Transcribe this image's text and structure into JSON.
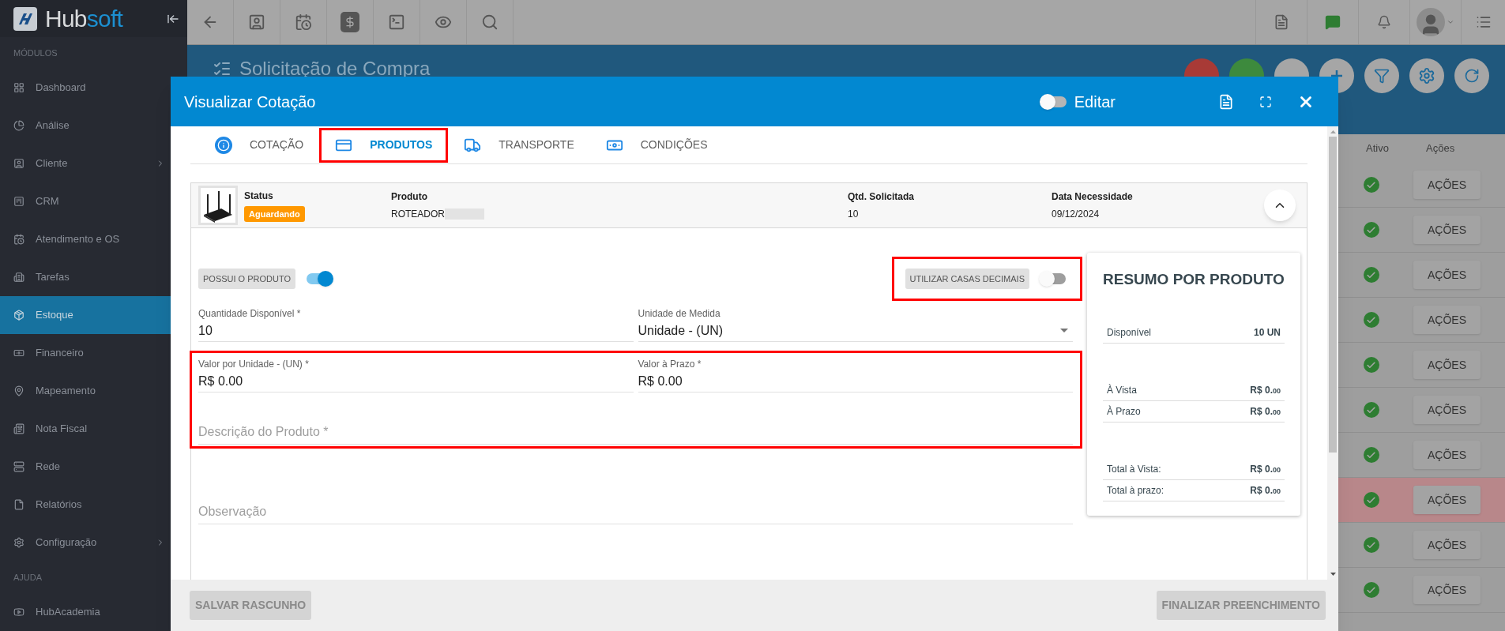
{
  "logo": {
    "parts": [
      "Hub",
      "soft"
    ]
  },
  "sidebar": {
    "sections": [
      {
        "heading": "MÓDULOS",
        "items": [
          {
            "label": "Dashboard",
            "selected": false,
            "submenu": false
          },
          {
            "label": "Análise",
            "selected": false,
            "submenu": false
          },
          {
            "label": "Cliente",
            "selected": false,
            "submenu": true
          },
          {
            "label": "CRM",
            "selected": false,
            "submenu": false
          },
          {
            "label": "Atendimento e OS",
            "selected": false,
            "submenu": false
          },
          {
            "label": "Tarefas",
            "selected": false,
            "submenu": false
          },
          {
            "label": "Estoque",
            "selected": true,
            "submenu": false
          },
          {
            "label": "Financeiro",
            "selected": false,
            "submenu": false
          },
          {
            "label": "Mapeamento",
            "selected": false,
            "submenu": false
          },
          {
            "label": "Nota Fiscal",
            "selected": false,
            "submenu": false
          },
          {
            "label": "Rede",
            "selected": false,
            "submenu": false
          },
          {
            "label": "Relatórios",
            "selected": false,
            "submenu": false
          },
          {
            "label": "Configuração",
            "selected": false,
            "submenu": true
          }
        ]
      },
      {
        "heading": "AJUDA",
        "items": [
          {
            "label": "HubAcademia",
            "selected": false,
            "submenu": false
          }
        ]
      }
    ]
  },
  "page": {
    "title": "Solicitação de Compra",
    "table": {
      "columns": [
        "Ativo",
        "Ações"
      ],
      "rows": [
        {
          "active": true,
          "highlighted": false,
          "action": "AÇÕES"
        },
        {
          "active": true,
          "highlighted": false,
          "action": "AÇÕES"
        },
        {
          "active": true,
          "highlighted": false,
          "action": "AÇÕES"
        },
        {
          "active": true,
          "highlighted": false,
          "action": "AÇÕES"
        },
        {
          "active": true,
          "highlighted": false,
          "action": "AÇÕES"
        },
        {
          "active": true,
          "highlighted": false,
          "action": "AÇÕES"
        },
        {
          "active": true,
          "highlighted": false,
          "action": "AÇÕES"
        },
        {
          "active": true,
          "highlighted": true,
          "action": "AÇÕES"
        },
        {
          "active": true,
          "highlighted": false,
          "action": "AÇÕES"
        },
        {
          "active": true,
          "highlighted": false,
          "action": "AÇÕES"
        }
      ]
    }
  },
  "modal": {
    "title": "Visualizar Cotação",
    "edit_toggle": {
      "label": "Editar",
      "on": false
    },
    "tabs": [
      {
        "label": "COTAÇÃO",
        "selected": false,
        "annotated": false
      },
      {
        "label": "PRODUTOS",
        "selected": true,
        "annotated": true
      },
      {
        "label": "TRANSPORTE",
        "selected": false,
        "annotated": false
      },
      {
        "label": "CONDIÇÕES",
        "selected": false,
        "annotated": false
      }
    ],
    "product": {
      "expanded": true,
      "columns": [
        {
          "label": "Status",
          "value": "Aguardando",
          "kind": "badge"
        },
        {
          "label": "Produto",
          "value": "ROTEADOR",
          "kind": "redacted"
        },
        {
          "label": "Qtd. Solicitada",
          "value": "10",
          "kind": "text"
        },
        {
          "label": "Data Necessidade",
          "value": "09/12/2024",
          "kind": "text"
        }
      ]
    },
    "toggles": [
      {
        "label": "POSSUI O PRODUTO",
        "on": true,
        "annotated": false
      },
      {
        "label": "UTILIZAR CASAS DECIMAIS",
        "on": false,
        "annotated": true
      }
    ],
    "field_groups": [
      {
        "annotated": false,
        "fields": [
          {
            "kind": "text",
            "label": "Quantidade Disponível *",
            "value": "10"
          },
          {
            "kind": "select",
            "label": "Unidade de Medida",
            "value": "Unidade - (UN)"
          }
        ]
      },
      {
        "annotated": true,
        "fields": [
          {
            "kind": "text",
            "label": "Valor por Unidade - (UN) *",
            "value": "R$ 0.00"
          },
          {
            "kind": "text",
            "label": "Valor à Prazo *",
            "value": "R$ 0.00"
          },
          {
            "kind": "textarea",
            "placeholder": "Descrição do Produto *"
          }
        ]
      },
      {
        "annotated": false,
        "fields": [
          {
            "kind": "textarea",
            "placeholder": "Observação"
          }
        ]
      }
    ],
    "summary": {
      "title": "RESUMO POR PRODUTO",
      "groups": [
        [
          {
            "label": "Disponível",
            "amount": "10 UN"
          }
        ],
        [
          {
            "label": "À Vista",
            "amount": "R$ 0.",
            "cents": "00"
          },
          {
            "label": "À Prazo",
            "amount": "R$ 0.",
            "cents": "00"
          }
        ],
        [
          {
            "label": "Total à Vista:",
            "amount": "R$ 0.",
            "cents": "00"
          },
          {
            "label": "Total à prazo:",
            "amount": "R$ 0.",
            "cents": "00"
          }
        ]
      ]
    },
    "footer": [
      {
        "label": "SALVAR RASCUNHO",
        "disabled": true
      },
      {
        "label": "FINALIZAR PREENCHIMENTO",
        "disabled": true
      }
    ]
  }
}
